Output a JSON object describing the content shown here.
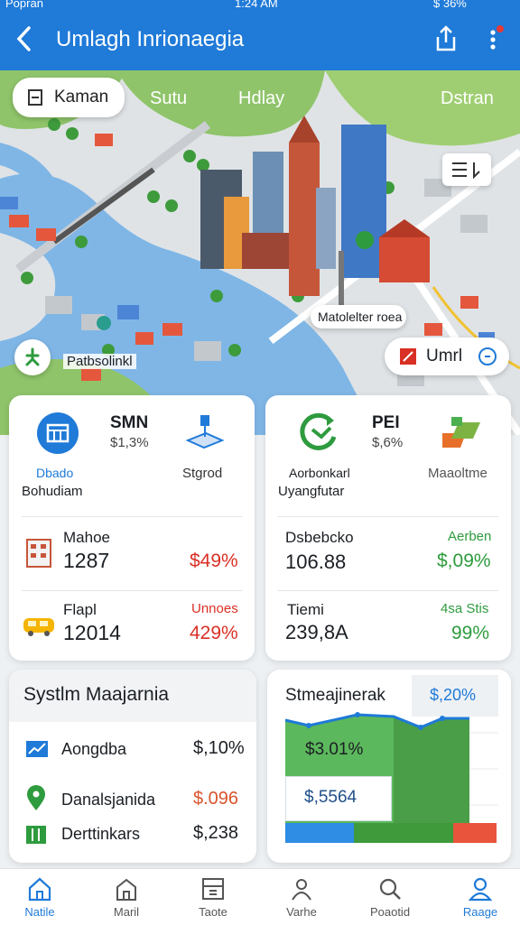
{
  "status": {
    "carrier": "Popran",
    "time": "1:24 AM",
    "battery": "$ 36%"
  },
  "appbar": {
    "title": "Umlagh Inrionaegia"
  },
  "map": {
    "search_chip": "Kaman",
    "area_labels": [
      "Sutu",
      "Hdlay",
      "Dstran"
    ],
    "place_label_1": "Patbsolinkl",
    "place_label_2": "Matolelter roea",
    "action_chip": "Umrl"
  },
  "card_left": {
    "metric1_title": "SMN",
    "metric1_sub": "$1,3%",
    "icon1_label": "Dbado",
    "icon1_sub": "Bohudiam",
    "icon2_label": "Stgrod",
    "rows": [
      {
        "label": "Mahoe",
        "value": "1287",
        "change": "$49%",
        "change_color": "#d93025"
      },
      {
        "label": "Flapl",
        "value": "12014",
        "change_label": "Unnoes",
        "change": "429%",
        "change_color": "#d93025"
      }
    ]
  },
  "card_right": {
    "metric1_title": "PEI",
    "metric1_sub": "$,6%",
    "icon1_label": "Aorbonkarl",
    "icon1_sub": "Uyangfutar",
    "icon2_label": "Maaoltme",
    "rows": [
      {
        "label": "Dsbebcko",
        "value": "106.88",
        "change_label": "Aerben",
        "change": "$,09%",
        "change_color": "#2e9b3e"
      },
      {
        "label": "Tiemi",
        "value": "239,8A",
        "change_label": "4sa Stis",
        "change": "99%",
        "change_color": "#2e9b3e"
      }
    ]
  },
  "system_card": {
    "title": "Systlm Maajarnia",
    "rows": [
      {
        "label": "Aongdba",
        "value": "$,10%",
        "value_color": "#1b1f24"
      },
      {
        "label": "Danalsjanida",
        "value": "$.096",
        "value_color": "#d9542b"
      },
      {
        "label": "Derttinkars",
        "value": "$,238",
        "value_color": "#1b1f24"
      }
    ]
  },
  "chart_card": {
    "title": "Stmeajinerak",
    "badge": "$,20%",
    "value1": "$3.01%",
    "value2": "$,5564"
  },
  "nav": {
    "items": [
      "Natile",
      "Maril",
      "Taote",
      "Varhe",
      "Poaotid",
      "Raage"
    ],
    "active": 5
  },
  "colors": {
    "primary": "#1f7ad8",
    "up": "#2e9b3e",
    "down": "#d93025"
  }
}
